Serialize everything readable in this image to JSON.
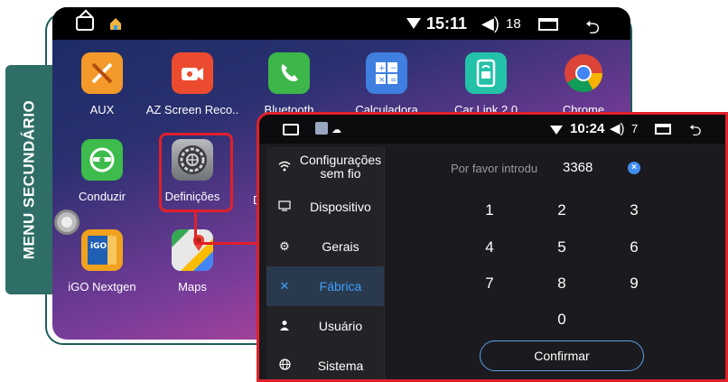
{
  "side_tab": {
    "label": "MENU SECUNDÁRIO"
  },
  "main_screen": {
    "status": {
      "time": "15:11",
      "volume": "18"
    },
    "apps": [
      {
        "label": "AUX",
        "icon": "aux-icon",
        "color": "#f39a2b"
      },
      {
        "label": "AZ Screen Reco..",
        "icon": "camera-record-icon",
        "color": "#ec4b2f"
      },
      {
        "label": "Bluetooth",
        "icon": "phone-icon",
        "color": "#3db64a"
      },
      {
        "label": "Calculadora",
        "icon": "calculator-icon",
        "color": "#3f7fe0"
      },
      {
        "label": "Car Link 2.0",
        "icon": "car-link-icon",
        "color": "#23c2a8"
      },
      {
        "label": "Chrome",
        "icon": "chrome-icon",
        "color": "#ffffff"
      },
      {
        "label": "Conduzir",
        "icon": "steering-wheel-icon",
        "color": "#3dbb4c"
      },
      {
        "label": "Definições",
        "icon": "settings-gear-icon",
        "color": "#8d8f93"
      },
      {
        "label": "iGO Nextgen",
        "icon": "igo-icon",
        "color": "#f0a21e"
      },
      {
        "label": "Maps",
        "icon": "maps-icon",
        "color": "#34a853"
      }
    ],
    "partial_label": "D"
  },
  "settings_screen": {
    "status": {
      "time": "10:24",
      "volume": "7"
    },
    "menu": [
      {
        "label": "Configurações sem fio",
        "icon": "wifi-icon",
        "active": false
      },
      {
        "label": "Dispositivo",
        "icon": "device-icon",
        "active": false
      },
      {
        "label": "Gerais",
        "icon": "gear-icon",
        "active": false
      },
      {
        "label": "Fábrica",
        "icon": "tools-icon",
        "active": true
      },
      {
        "label": "Usuário",
        "icon": "user-icon",
        "active": false
      },
      {
        "label": "Sistema",
        "icon": "globe-icon",
        "active": false
      }
    ],
    "password": {
      "placeholder": "Por favor introdu",
      "value": "3368"
    },
    "keypad": [
      "1",
      "2",
      "3",
      "4",
      "5",
      "6",
      "7",
      "8",
      "9",
      "0"
    ],
    "confirm_label": "Confirmar",
    "accent_color": "#3ea0ff"
  }
}
